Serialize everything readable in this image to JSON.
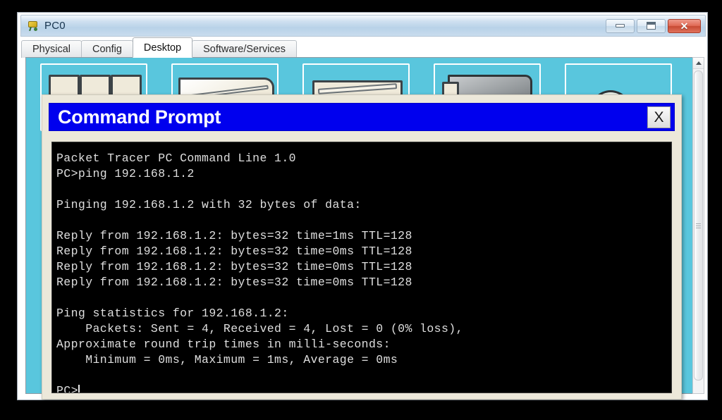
{
  "window": {
    "title": "PC0",
    "icon": "network-device-icon",
    "controls": {
      "minimize_label": "–",
      "maximize_label": "□",
      "close_label": "✕"
    }
  },
  "tabs": [
    {
      "label": "Physical",
      "active": false
    },
    {
      "label": "Config",
      "active": false
    },
    {
      "label": "Desktop",
      "active": true
    },
    {
      "label": "Software/Services",
      "active": false
    }
  ],
  "desktop": {
    "background_color": "#59c6dd",
    "icons": [
      {
        "name": "desktop-icon-1"
      },
      {
        "name": "desktop-icon-2"
      },
      {
        "name": "desktop-icon-3"
      },
      {
        "name": "desktop-icon-4"
      },
      {
        "name": "desktop-icon-5"
      }
    ]
  },
  "scrollbar": {
    "up_arrow": "scroll-up-icon",
    "orientation": "vertical"
  },
  "command_prompt": {
    "title": "Command Prompt",
    "title_bar_color": "#0000ee",
    "close_label": "X",
    "terminal": {
      "background_color": "#000000",
      "text_color": "#dfdfdf",
      "lines": [
        "Packet Tracer PC Command Line 1.0",
        "PC>ping 192.168.1.2",
        "",
        "Pinging 192.168.1.2 with 32 bytes of data:",
        "",
        "Reply from 192.168.1.2: bytes=32 time=1ms TTL=128",
        "Reply from 192.168.1.2: bytes=32 time=0ms TTL=128",
        "Reply from 192.168.1.2: bytes=32 time=0ms TTL=128",
        "Reply from 192.168.1.2: bytes=32 time=0ms TTL=128",
        "",
        "Ping statistics for 192.168.1.2:",
        "    Packets: Sent = 4, Received = 4, Lost = 0 (0% loss),",
        "Approximate round trip times in milli-seconds:",
        "    Minimum = 0ms, Maximum = 1ms, Average = 0ms",
        "",
        ""
      ],
      "prompt": "PC>"
    }
  }
}
